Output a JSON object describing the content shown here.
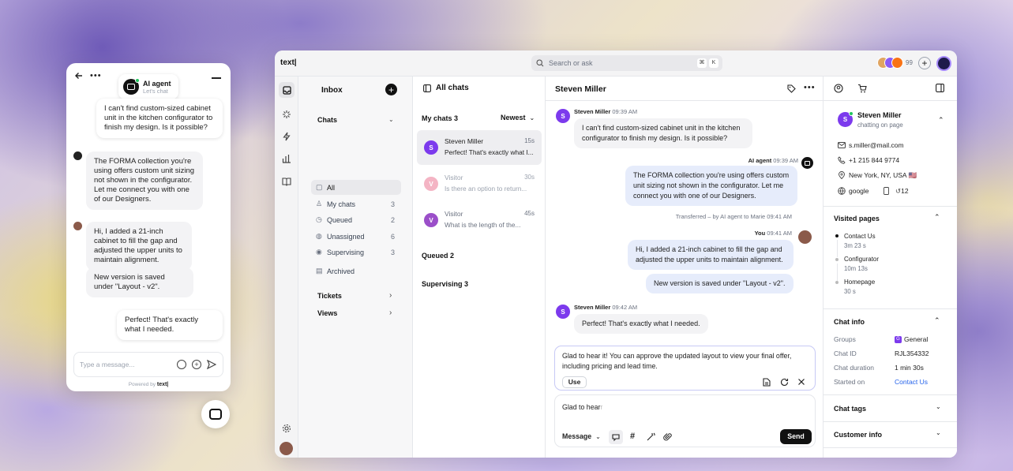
{
  "widget": {
    "agent_name": "AI agent",
    "agent_sub": "Let's chat",
    "messages": [
      {
        "from": "visitor",
        "text": "I can't find custom-sized cabinet unit in the kitchen configurator to finish my design. Is it possible?"
      },
      {
        "from": "ai",
        "text": "The FORMA collection you're using offers custom unit sizing not shown in the configurator. Let me connect you with one of our Designers."
      },
      {
        "from": "agent",
        "text": "Hi, I added a 21-inch cabinet to fill the gap and adjusted the upper units to maintain alignment."
      },
      {
        "from": "agent",
        "text": "New version is saved under \"Layout - v2\"."
      },
      {
        "from": "visitor",
        "text": "Perfect! That's exactly what I needed."
      }
    ],
    "input_placeholder": "Type a message...",
    "powered_by": "Powered by",
    "brand": "text|"
  },
  "topbar": {
    "logo": "text|",
    "search_placeholder": "Search or ask",
    "shortcut_1": "⌘",
    "shortcut_2": "K",
    "avatar_count": "99"
  },
  "inbox": {
    "title": "Inbox",
    "chats_label": "Chats",
    "items": [
      {
        "label": "All",
        "count": ""
      },
      {
        "label": "My chats",
        "count": "3"
      },
      {
        "label": "Queued",
        "count": "2"
      },
      {
        "label": "Unassigned",
        "count": "6"
      },
      {
        "label": "Supervising",
        "count": "3"
      },
      {
        "label": "Archived",
        "count": ""
      }
    ],
    "tickets_label": "Tickets",
    "views_label": "Views"
  },
  "list": {
    "title": "All chats",
    "my_chats": "My chats 3",
    "sort": "Newest",
    "chats": [
      {
        "initial": "S",
        "name": "Steven Miller",
        "time": "15s",
        "preview": "Perfect! That's exactly what I...",
        "color": "#7c3aed"
      },
      {
        "initial": "V",
        "name": "Visitor",
        "time": "30s",
        "preview": "Is there an option to return...",
        "color": "#f4b4c4"
      },
      {
        "initial": "V",
        "name": "Visitor",
        "time": "45s",
        "preview": "What is the length of the...",
        "color": "#9b4fc9"
      }
    ],
    "queued": "Queued 2",
    "supervising": "Supervising 3"
  },
  "conversation": {
    "title": "Steven Miller",
    "m1_name": "Steven Miller",
    "m1_time": "09:39 AM",
    "m1_text": "I can't find custom-sized cabinet unit in the kitchen configurator to finish my design. Is it possible?",
    "ai_name": "AI agent",
    "ai_time": "09:39 AM",
    "ai_text": "The FORMA collection you're using offers custom unit sizing not shown in the configurator. Let me connect you with one of our Designers.",
    "transfer": "Transferred – by AI agent to Marie 09:41 AM",
    "you_name": "You",
    "you_time": "09:41 AM",
    "you_text1": "Hi, I added a 21-inch cabinet to fill the gap and adjusted the upper units to maintain alignment.",
    "you_text2": "New version is saved under \"Layout - v2\".",
    "m2_name": "Steven Miller",
    "m2_time": "09:42 AM",
    "m2_text": "Perfect! That's exactly what I needed.",
    "suggestion": "Glad to hear it! You can approve the updated layout to view your final offer, including pricing and lead time.",
    "use_label": "Use",
    "composer_typed": "Glad to hear",
    "composer_ghost": "r",
    "message_mode": "Message",
    "send_label": "Send"
  },
  "details": {
    "name": "Steven Miller",
    "status": "chatting on page",
    "email": "s.miller@mail.com",
    "phone": "+1 215 844 9774",
    "location": "New York, NY, USA",
    "flag": "🇺🇸",
    "source": "google",
    "visits": "12",
    "visited_title": "Visited pages",
    "pages": [
      {
        "name": "Contact Us",
        "time": "3m 23 s"
      },
      {
        "name": "Configurator",
        "time": "10m 13s"
      },
      {
        "name": "Homepage",
        "time": "30 s"
      }
    ],
    "chat_info_title": "Chat info",
    "groups_label": "Groups",
    "groups_value": "General",
    "chatid_label": "Chat ID",
    "chatid_value": "RJL354332",
    "duration_label": "Chat duration",
    "duration_value": "1 min 30s",
    "started_label": "Started on",
    "started_value": "Contact Us",
    "tags_title": "Chat tags",
    "customer_title": "Customer info"
  },
  "colors": {
    "accent": "#7c3aed",
    "link": "#2563eb",
    "ai_bubble": "#e6ecfb"
  }
}
